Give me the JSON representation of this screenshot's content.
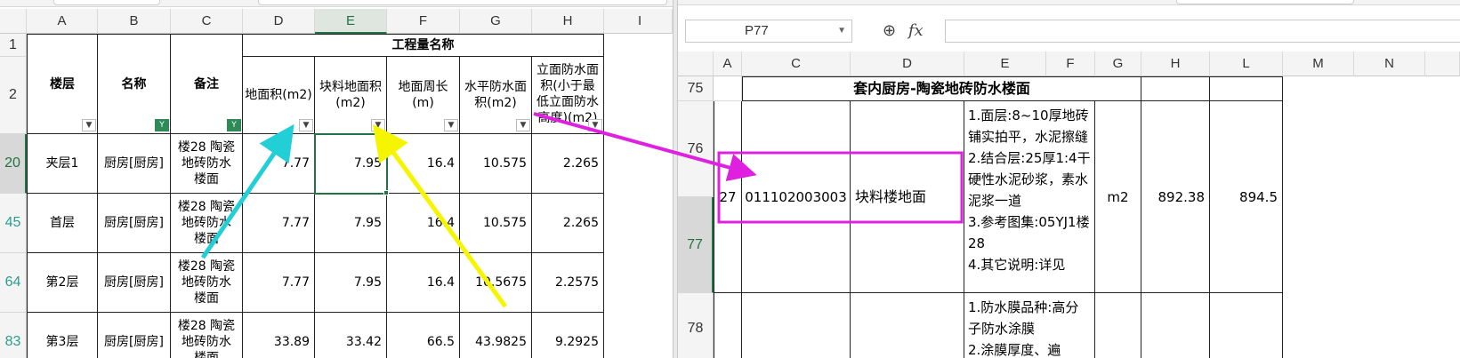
{
  "left": {
    "columns": [
      "A",
      "B",
      "C",
      "D",
      "E",
      "F",
      "G",
      "H",
      "I"
    ],
    "rows": [
      "1",
      "2",
      "20",
      "45",
      "64",
      "83"
    ],
    "group_header": "工程量名称",
    "headers": {
      "floor": "楼层",
      "name": "名称",
      "remark": "备注",
      "floor_area": "地面积(m2)",
      "block_area": "块料地面积(m2)",
      "perimeter": "地面周长(m)",
      "horiz_wp": "水平防水面积(m2)",
      "vert_wp": "立面防水面积(小于最低立面防水高度)(m2)"
    },
    "data": [
      {
        "floor": "夹层1",
        "name": "厨房[厨房]",
        "remark": "楼28 陶瓷地砖防水楼面",
        "d": "7.77",
        "e": "7.95",
        "f": "16.4",
        "g": "10.575",
        "h": "2.265"
      },
      {
        "floor": "首层",
        "name": "厨房[厨房]",
        "remark": "楼28 陶瓷地砖防水楼面",
        "d": "7.77",
        "e": "7.95",
        "f": "16.4",
        "g": "10.575",
        "h": "2.265"
      },
      {
        "floor": "第2层",
        "name": "厨房[厨房]",
        "remark": "楼28 陶瓷地砖防水楼面",
        "d": "7.77",
        "e": "7.95",
        "f": "16.4",
        "g": "10.5675",
        "h": "2.2575"
      },
      {
        "floor": "第3层",
        "name": "厨房[厨房]",
        "remark": "楼28 陶瓷地砖防水楼面",
        "d": "33.89",
        "e": "33.42",
        "f": "66.5",
        "g": "43.9825",
        "h": "9.2925"
      }
    ]
  },
  "right": {
    "name_box": "P77",
    "fx_label": "fx",
    "columns": [
      "A",
      "C",
      "D",
      "E",
      "F",
      "G",
      "H",
      "L",
      "M",
      "N"
    ],
    "rows": [
      "75",
      "76",
      "77",
      "78"
    ],
    "section_title": "套内厨房-陶瓷地砖防水楼面",
    "item": {
      "seq": "27",
      "code": "011102003003",
      "name": "块料楼地面",
      "desc": "1.面层:8~10厚地砖铺实拍平，水泥擦缝\n2.结合层:25厚1:4干硬性水泥砂浆，素水泥浆一道\n3.参考图集:05YJ1楼28\n4.其它说明:详见",
      "unit": "m2",
      "qty_h": "892.38",
      "qty_l": "894.5"
    },
    "next_desc": "1.防水膜品种:高分子防水涂膜\n2.涂膜厚度、遍"
  },
  "annotation_colors": {
    "cyan": "#22cfd6",
    "yellow": "#f5f500",
    "magenta": "#e020e0",
    "selection": "#217346"
  }
}
